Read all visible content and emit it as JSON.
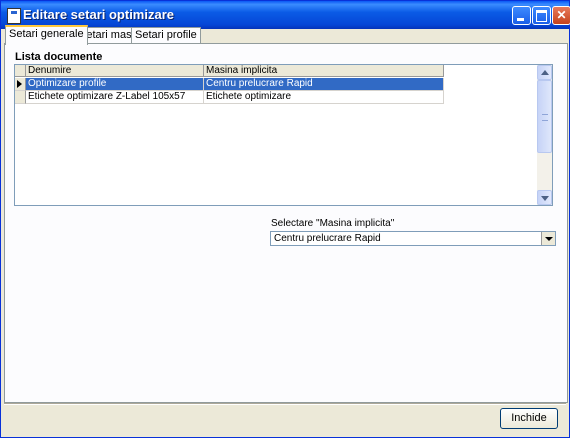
{
  "window": {
    "title": "Editare setari optimizare",
    "controls": [
      "minimize-icon",
      "maximize-icon",
      "close-icon"
    ],
    "accent": "#0546d6"
  },
  "tabs": [
    {
      "label": "Setari generale",
      "active": true
    },
    {
      "label": "Setari masini",
      "active": false
    },
    {
      "label": "Setari profile",
      "active": false
    }
  ],
  "documents": {
    "section_label": "Lista documente",
    "columns": [
      "Denumire",
      "Masina implicita"
    ],
    "rows": [
      {
        "name": "Optimizare profile",
        "machine": "Centru prelucrare Rapid",
        "selected": true
      },
      {
        "name": "Etichete optimizare Z-Label 105x57",
        "machine": "Etichete optimizare",
        "selected": false
      }
    ],
    "selection_color": "#316ac5"
  },
  "machine_select": {
    "label": "Selectare \"Masina implicita\"",
    "value": "Centru prelucrare Rapid"
  },
  "footer": {
    "close_label": "Inchide"
  }
}
